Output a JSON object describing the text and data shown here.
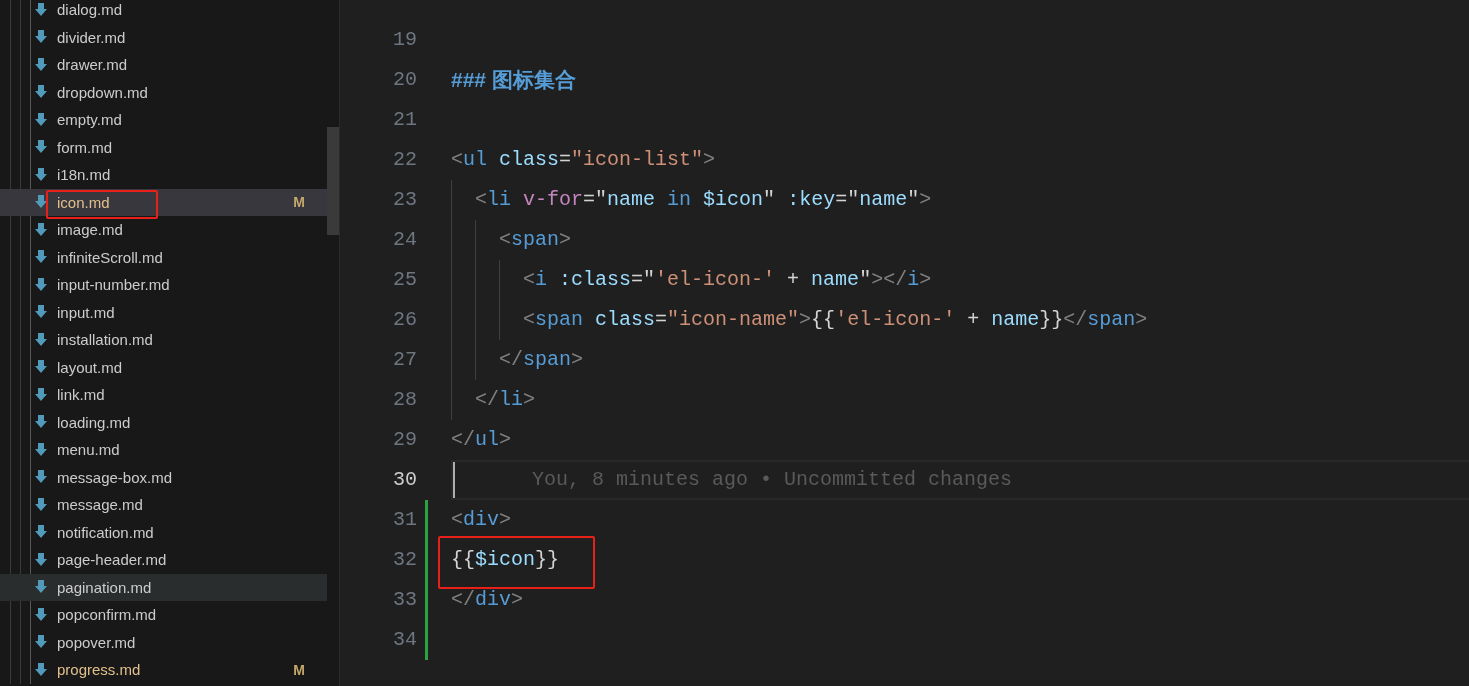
{
  "explorer": {
    "items": [
      {
        "name": "dialog.md",
        "modified": false,
        "selected": false,
        "hovered": false
      },
      {
        "name": "divider.md",
        "modified": false,
        "selected": false,
        "hovered": false
      },
      {
        "name": "drawer.md",
        "modified": false,
        "selected": false,
        "hovered": false
      },
      {
        "name": "dropdown.md",
        "modified": false,
        "selected": false,
        "hovered": false
      },
      {
        "name": "empty.md",
        "modified": false,
        "selected": false,
        "hovered": false
      },
      {
        "name": "form.md",
        "modified": false,
        "selected": false,
        "hovered": false
      },
      {
        "name": "i18n.md",
        "modified": false,
        "selected": false,
        "hovered": false
      },
      {
        "name": "icon.md",
        "modified": true,
        "badge": "M",
        "selected": true,
        "hovered": false,
        "annotated": true
      },
      {
        "name": "image.md",
        "modified": false,
        "selected": false,
        "hovered": false
      },
      {
        "name": "infiniteScroll.md",
        "modified": false,
        "selected": false,
        "hovered": false
      },
      {
        "name": "input-number.md",
        "modified": false,
        "selected": false,
        "hovered": false
      },
      {
        "name": "input.md",
        "modified": false,
        "selected": false,
        "hovered": false
      },
      {
        "name": "installation.md",
        "modified": false,
        "selected": false,
        "hovered": false
      },
      {
        "name": "layout.md",
        "modified": false,
        "selected": false,
        "hovered": false
      },
      {
        "name": "link.md",
        "modified": false,
        "selected": false,
        "hovered": false
      },
      {
        "name": "loading.md",
        "modified": false,
        "selected": false,
        "hovered": false
      },
      {
        "name": "menu.md",
        "modified": false,
        "selected": false,
        "hovered": false
      },
      {
        "name": "message-box.md",
        "modified": false,
        "selected": false,
        "hovered": false
      },
      {
        "name": "message.md",
        "modified": false,
        "selected": false,
        "hovered": false
      },
      {
        "name": "notification.md",
        "modified": false,
        "selected": false,
        "hovered": false
      },
      {
        "name": "page-header.md",
        "modified": false,
        "selected": false,
        "hovered": false
      },
      {
        "name": "pagination.md",
        "modified": false,
        "selected": false,
        "hovered": true
      },
      {
        "name": "popconfirm.md",
        "modified": false,
        "selected": false,
        "hovered": false
      },
      {
        "name": "popover.md",
        "modified": false,
        "selected": false,
        "hovered": false
      },
      {
        "name": "progress.md",
        "modified": true,
        "badge": "M",
        "selected": false,
        "hovered": false
      }
    ]
  },
  "editor": {
    "lines": [
      {
        "number": "19",
        "current": false,
        "changed": false
      },
      {
        "number": "20",
        "current": false,
        "changed": false,
        "tokens": [
          {
            "kind": "heading",
            "text": "### 图标集合"
          }
        ]
      },
      {
        "number": "21",
        "current": false,
        "changed": false
      },
      {
        "number": "22",
        "current": false,
        "changed": false,
        "tokens": [
          {
            "kind": "punct",
            "text": "<"
          },
          {
            "kind": "tag",
            "text": "ul"
          },
          {
            "kind": "attr",
            "text": " class"
          },
          {
            "kind": "text",
            "text": "="
          },
          {
            "kind": "string",
            "text": "\"icon-list\""
          },
          {
            "kind": "punct",
            "text": ">"
          }
        ]
      },
      {
        "number": "23",
        "current": false,
        "changed": false,
        "tokens": [
          {
            "kind": "punct",
            "text": "  <"
          },
          {
            "kind": "tag",
            "text": "li"
          },
          {
            "kind": "directive",
            "text": " v-for"
          },
          {
            "kind": "text",
            "text": "=\""
          },
          {
            "kind": "attr",
            "text": "name"
          },
          {
            "kind": "tag",
            "text": " in "
          },
          {
            "kind": "attr",
            "text": "$icon"
          },
          {
            "kind": "text",
            "text": "\" "
          },
          {
            "kind": "attr",
            "text": ":key"
          },
          {
            "kind": "text",
            "text": "=\""
          },
          {
            "kind": "attr",
            "text": "name"
          },
          {
            "kind": "text",
            "text": "\""
          },
          {
            "kind": "punct",
            "text": ">"
          }
        ]
      },
      {
        "number": "24",
        "current": false,
        "changed": false,
        "tokens": [
          {
            "kind": "punct",
            "text": "    <"
          },
          {
            "kind": "tag",
            "text": "span"
          },
          {
            "kind": "punct",
            "text": ">"
          }
        ]
      },
      {
        "number": "25",
        "current": false,
        "changed": false,
        "tokens": [
          {
            "kind": "punct",
            "text": "      <"
          },
          {
            "kind": "tag",
            "text": "i"
          },
          {
            "kind": "attr",
            "text": " :class"
          },
          {
            "kind": "text",
            "text": "=\""
          },
          {
            "kind": "string",
            "text": "'el-icon-'"
          },
          {
            "kind": "text",
            "text": " + "
          },
          {
            "kind": "attr",
            "text": "name"
          },
          {
            "kind": "text",
            "text": "\""
          },
          {
            "kind": "punct",
            "text": "></"
          },
          {
            "kind": "tag",
            "text": "i"
          },
          {
            "kind": "punct",
            "text": ">"
          }
        ]
      },
      {
        "number": "26",
        "current": false,
        "changed": false,
        "tokens": [
          {
            "kind": "punct",
            "text": "      <"
          },
          {
            "kind": "tag",
            "text": "span"
          },
          {
            "kind": "attr",
            "text": " class"
          },
          {
            "kind": "text",
            "text": "="
          },
          {
            "kind": "string",
            "text": "\"icon-name\""
          },
          {
            "kind": "punct",
            "text": ">"
          },
          {
            "kind": "text",
            "text": "{{"
          },
          {
            "kind": "string",
            "text": "'el-icon-'"
          },
          {
            "kind": "text",
            "text": " + "
          },
          {
            "kind": "attr",
            "text": "name"
          },
          {
            "kind": "text",
            "text": "}}"
          },
          {
            "kind": "punct",
            "text": "</"
          },
          {
            "kind": "tag",
            "text": "span"
          },
          {
            "kind": "punct",
            "text": ">"
          }
        ]
      },
      {
        "number": "27",
        "current": false,
        "changed": false,
        "tokens": [
          {
            "kind": "punct",
            "text": "    </"
          },
          {
            "kind": "tag",
            "text": "span"
          },
          {
            "kind": "punct",
            "text": ">"
          }
        ]
      },
      {
        "number": "28",
        "current": false,
        "changed": false,
        "tokens": [
          {
            "kind": "punct",
            "text": "  </"
          },
          {
            "kind": "tag",
            "text": "li"
          },
          {
            "kind": "punct",
            "text": ">"
          }
        ]
      },
      {
        "number": "29",
        "current": false,
        "changed": false,
        "tokens": [
          {
            "kind": "punct",
            "text": "</"
          },
          {
            "kind": "tag",
            "text": "ul"
          },
          {
            "kind": "punct",
            "text": ">"
          }
        ]
      },
      {
        "number": "30",
        "current": true,
        "changed": false,
        "blame": "You, 8 minutes ago • Uncommitted changes"
      },
      {
        "number": "31",
        "current": false,
        "changed": true,
        "tokens": [
          {
            "kind": "punct",
            "text": "<"
          },
          {
            "kind": "tag",
            "text": "div"
          },
          {
            "kind": "punct",
            "text": ">"
          }
        ]
      },
      {
        "number": "32",
        "current": false,
        "changed": true,
        "annotated": true,
        "tokens": [
          {
            "kind": "text",
            "text": "{{"
          },
          {
            "kind": "attr",
            "text": "$icon"
          },
          {
            "kind": "text",
            "text": "}}"
          }
        ]
      },
      {
        "number": "33",
        "current": false,
        "changed": true,
        "tokens": [
          {
            "kind": "punct",
            "text": "</"
          },
          {
            "kind": "tag",
            "text": "div"
          },
          {
            "kind": "punct",
            "text": ">"
          }
        ]
      },
      {
        "number": "34",
        "current": false,
        "changed": true
      }
    ]
  }
}
